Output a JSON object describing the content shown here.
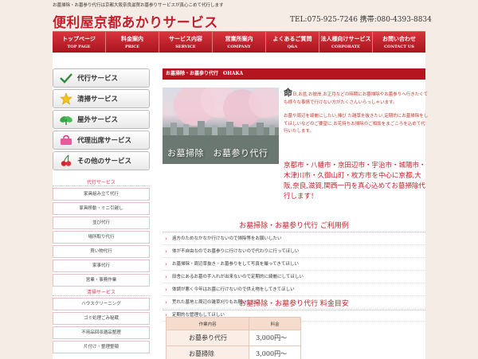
{
  "topbar": {
    "text": "お墓掃除・お墓参り代行は京都大阪奈良滋賀お墓参りサービスが真心こめて代行します"
  },
  "header": {
    "logo": "便利屋京都あかりサービス",
    "phone": "TEL:075-925-7246 携帯:080-4393-8834"
  },
  "nav": [
    {
      "ja": "トップページ",
      "en": "TOP PAGE"
    },
    {
      "ja": "料金案内",
      "en": "PRICE"
    },
    {
      "ja": "サービス内容",
      "en": "SERVICE"
    },
    {
      "ja": "営業所案内",
      "en": "COMPANY"
    },
    {
      "ja": "よくあるご質問",
      "en": "Q&A"
    },
    {
      "ja": "法人様向けサービス",
      "en": "CORPORATE"
    },
    {
      "ja": "お問い合わせ",
      "en": "CONTACT US"
    }
  ],
  "sidebar": {
    "buttons": [
      {
        "label": "代行サービス",
        "icon": "check-icon"
      },
      {
        "label": "清掃サービス",
        "icon": "star-icon"
      },
      {
        "label": "屋外サービス",
        "icon": "leaf-icon"
      },
      {
        "label": "代理出席サービス",
        "icon": "bag-icon"
      },
      {
        "label": "その他のサービス",
        "icon": "cherry-icon"
      }
    ],
    "section1": "代行サービス",
    "links1": [
      "家具組み立て代行",
      "家具移動・ミニ引越し",
      "並び代行",
      "場所取り代行",
      "買い物代行",
      "家事代行",
      "営業・事務作業"
    ],
    "section2": "清掃サービス",
    "links2": [
      "ハウスクリーニング",
      "ゴミ処理ごみ秘蔵",
      "不用品回収遺品整理",
      "片付け・整理整頓"
    ]
  },
  "main": {
    "title": "お墓掃除・お墓参り代行　OHAKA",
    "hero_caption": "お墓掃除　お墓参り代行",
    "intro_big": "命",
    "intro_text": "日,お盆,お彼岸,お正月などの時期にお墓掃除やお墓参りへ行きたくても様々な事情で行けない方がたくさんいらっしゃいます。",
    "intro_text2": "お墓や周辺を綺麗にしたい,挿び た雑草を抜きたい,定期的にお墓掃除をしてほしいなどのご要望に,お花持ちお掃除のご相談をまごころを込めて代行いたします。",
    "areas": "京都市・八幡市・京田辺市・宇治市・城陽市・木津川市・久御山町・枚方市を中心に京都,大阪,奈良,滋賀,関西一円を真心込めてお墓掃除代行します！",
    "section1_title": "お墓掃除・お墓参り代行 ご利用例",
    "examples": [
      "遠方のためなかなか行けないので掃除等をお願いしたい",
      "体が不自由なのでお墓参りに行けないので代わりに行ってほしい",
      "お墓掃除・周辺草抜き・お墓参りをして写真を撮ってきてほしい",
      "田舎にあるお墓の手入れが出来ないので定期的に綺麗にしてほしい",
      "体調が悪く今年はお墓に行けないので供え物をしてきてほしい",
      "荒れた墓地と周辺の雑草刈りもお願いしたい",
      "定期的な管理もしてほしい"
    ],
    "section2_title": "お墓掃除・お墓参り代行 料金目安",
    "table_headers": [
      "作業内容",
      "料金"
    ],
    "prices": [
      {
        "service": "お墓参り代行",
        "price": "3,000円～"
      },
      {
        "service": "お墓掃除",
        "price": "3,000円～"
      }
    ]
  }
}
